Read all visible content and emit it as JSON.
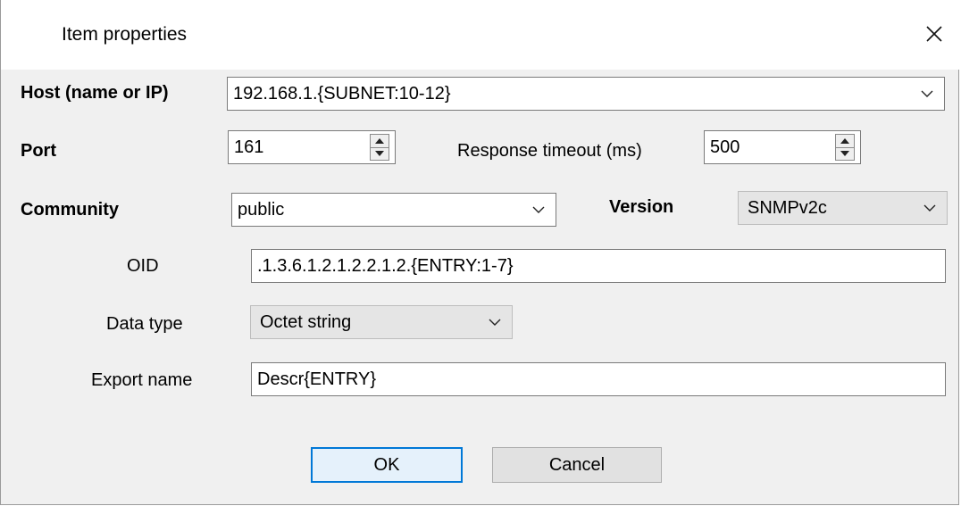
{
  "window": {
    "title": "Item properties",
    "close_icon": "close-icon"
  },
  "host": {
    "label": "Host (name or IP)",
    "value": "192.168.1.{SUBNET:10-12}"
  },
  "port": {
    "label": "Port",
    "value": "161"
  },
  "timeout": {
    "label": "Response timeout (ms)",
    "value": "500"
  },
  "community": {
    "label": "Community",
    "value": "public"
  },
  "version": {
    "label": "Version",
    "value": "SNMPv2c"
  },
  "oid": {
    "label": "OID",
    "value": ".1.3.6.1.2.1.2.2.1.2.{ENTRY:1-7}"
  },
  "data_type": {
    "label": "Data type",
    "value": "Octet string"
  },
  "export_name": {
    "label": "Export name",
    "value": "Descr{ENTRY}"
  },
  "buttons": {
    "ok": "OK",
    "cancel": "Cancel"
  },
  "colors": {
    "dialog_bg": "#f0f0f0",
    "title_bg": "#ffffff",
    "default_button_border": "#0078d7"
  }
}
